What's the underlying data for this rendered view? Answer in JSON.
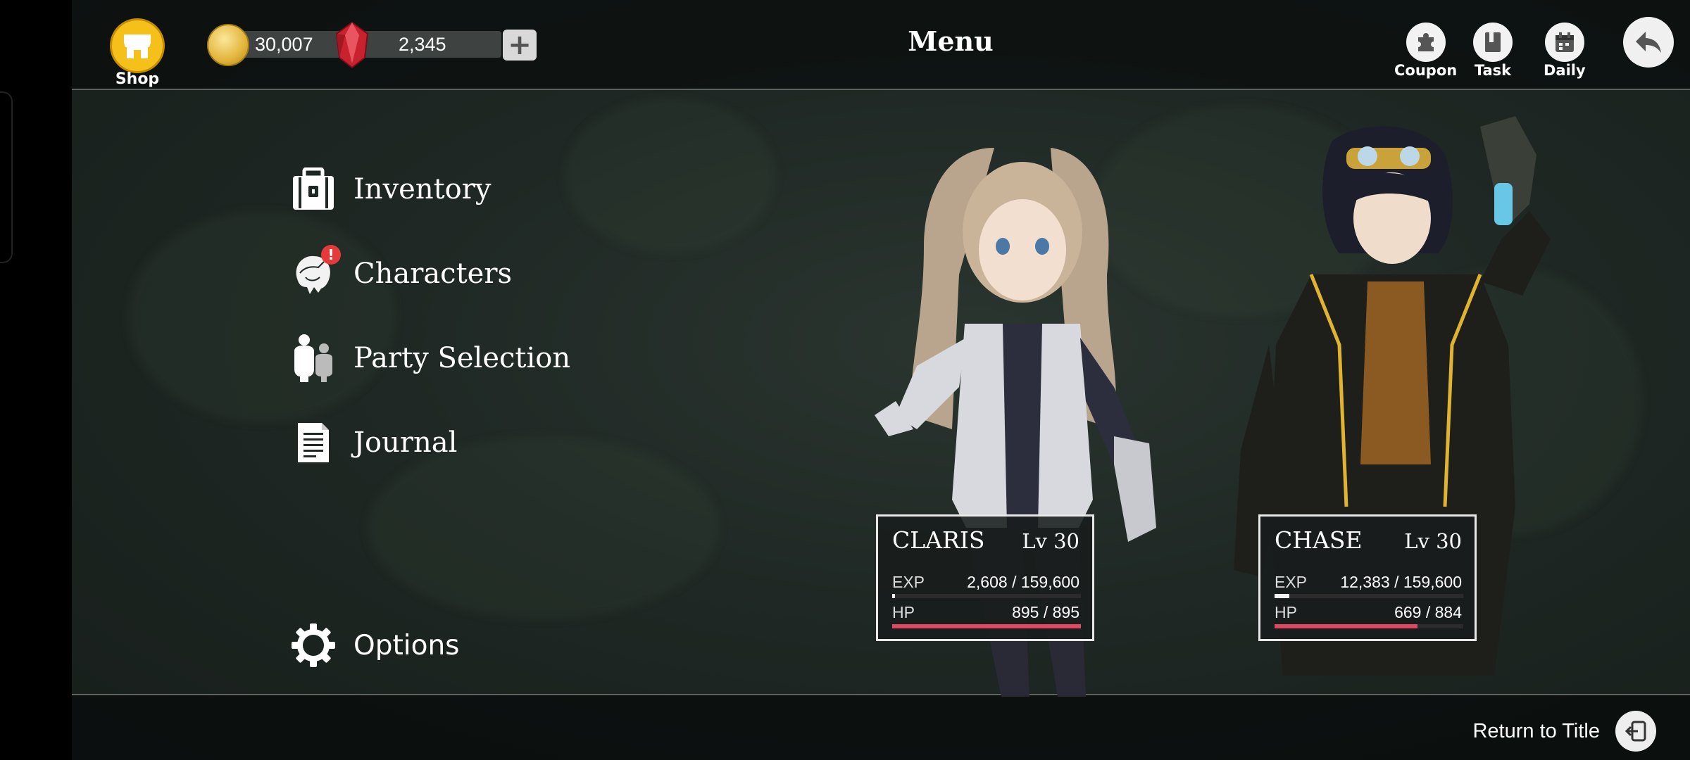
{
  "header": {
    "title": "Menu",
    "shop_label": "Shop",
    "gold": "30,007",
    "gems": "2,345",
    "coupon_label": "Coupon",
    "task_label": "Task",
    "daily_label": "Daily"
  },
  "menu": {
    "items": [
      {
        "label": "Inventory",
        "icon": "chest-icon"
      },
      {
        "label": "Characters",
        "icon": "character-portrait-icon",
        "badge": "!"
      },
      {
        "label": "Party Selection",
        "icon": "party-icon"
      },
      {
        "label": "Journal",
        "icon": "document-icon"
      }
    ],
    "options_label": "Options"
  },
  "party": [
    {
      "name": "CLARIS",
      "level": "Lv 30",
      "exp_label": "EXP",
      "exp": "2,608 / 159,600",
      "exp_fraction": 0.016,
      "hp_label": "HP",
      "hp": "895 / 895",
      "hp_fraction": 1.0
    },
    {
      "name": "CHASE",
      "level": "Lv 30",
      "exp_label": "EXP",
      "exp": "12,383 / 159,600",
      "exp_fraction": 0.078,
      "hp_label": "HP",
      "hp": "669 / 884",
      "hp_fraction": 0.757
    }
  ],
  "footer": {
    "return_label": "Return to Title"
  },
  "colors": {
    "hp_bar": "#e04760",
    "exp_bar": "#f2f2f2",
    "shop_gold": "#f5c019",
    "badge": "#e43a3a"
  }
}
